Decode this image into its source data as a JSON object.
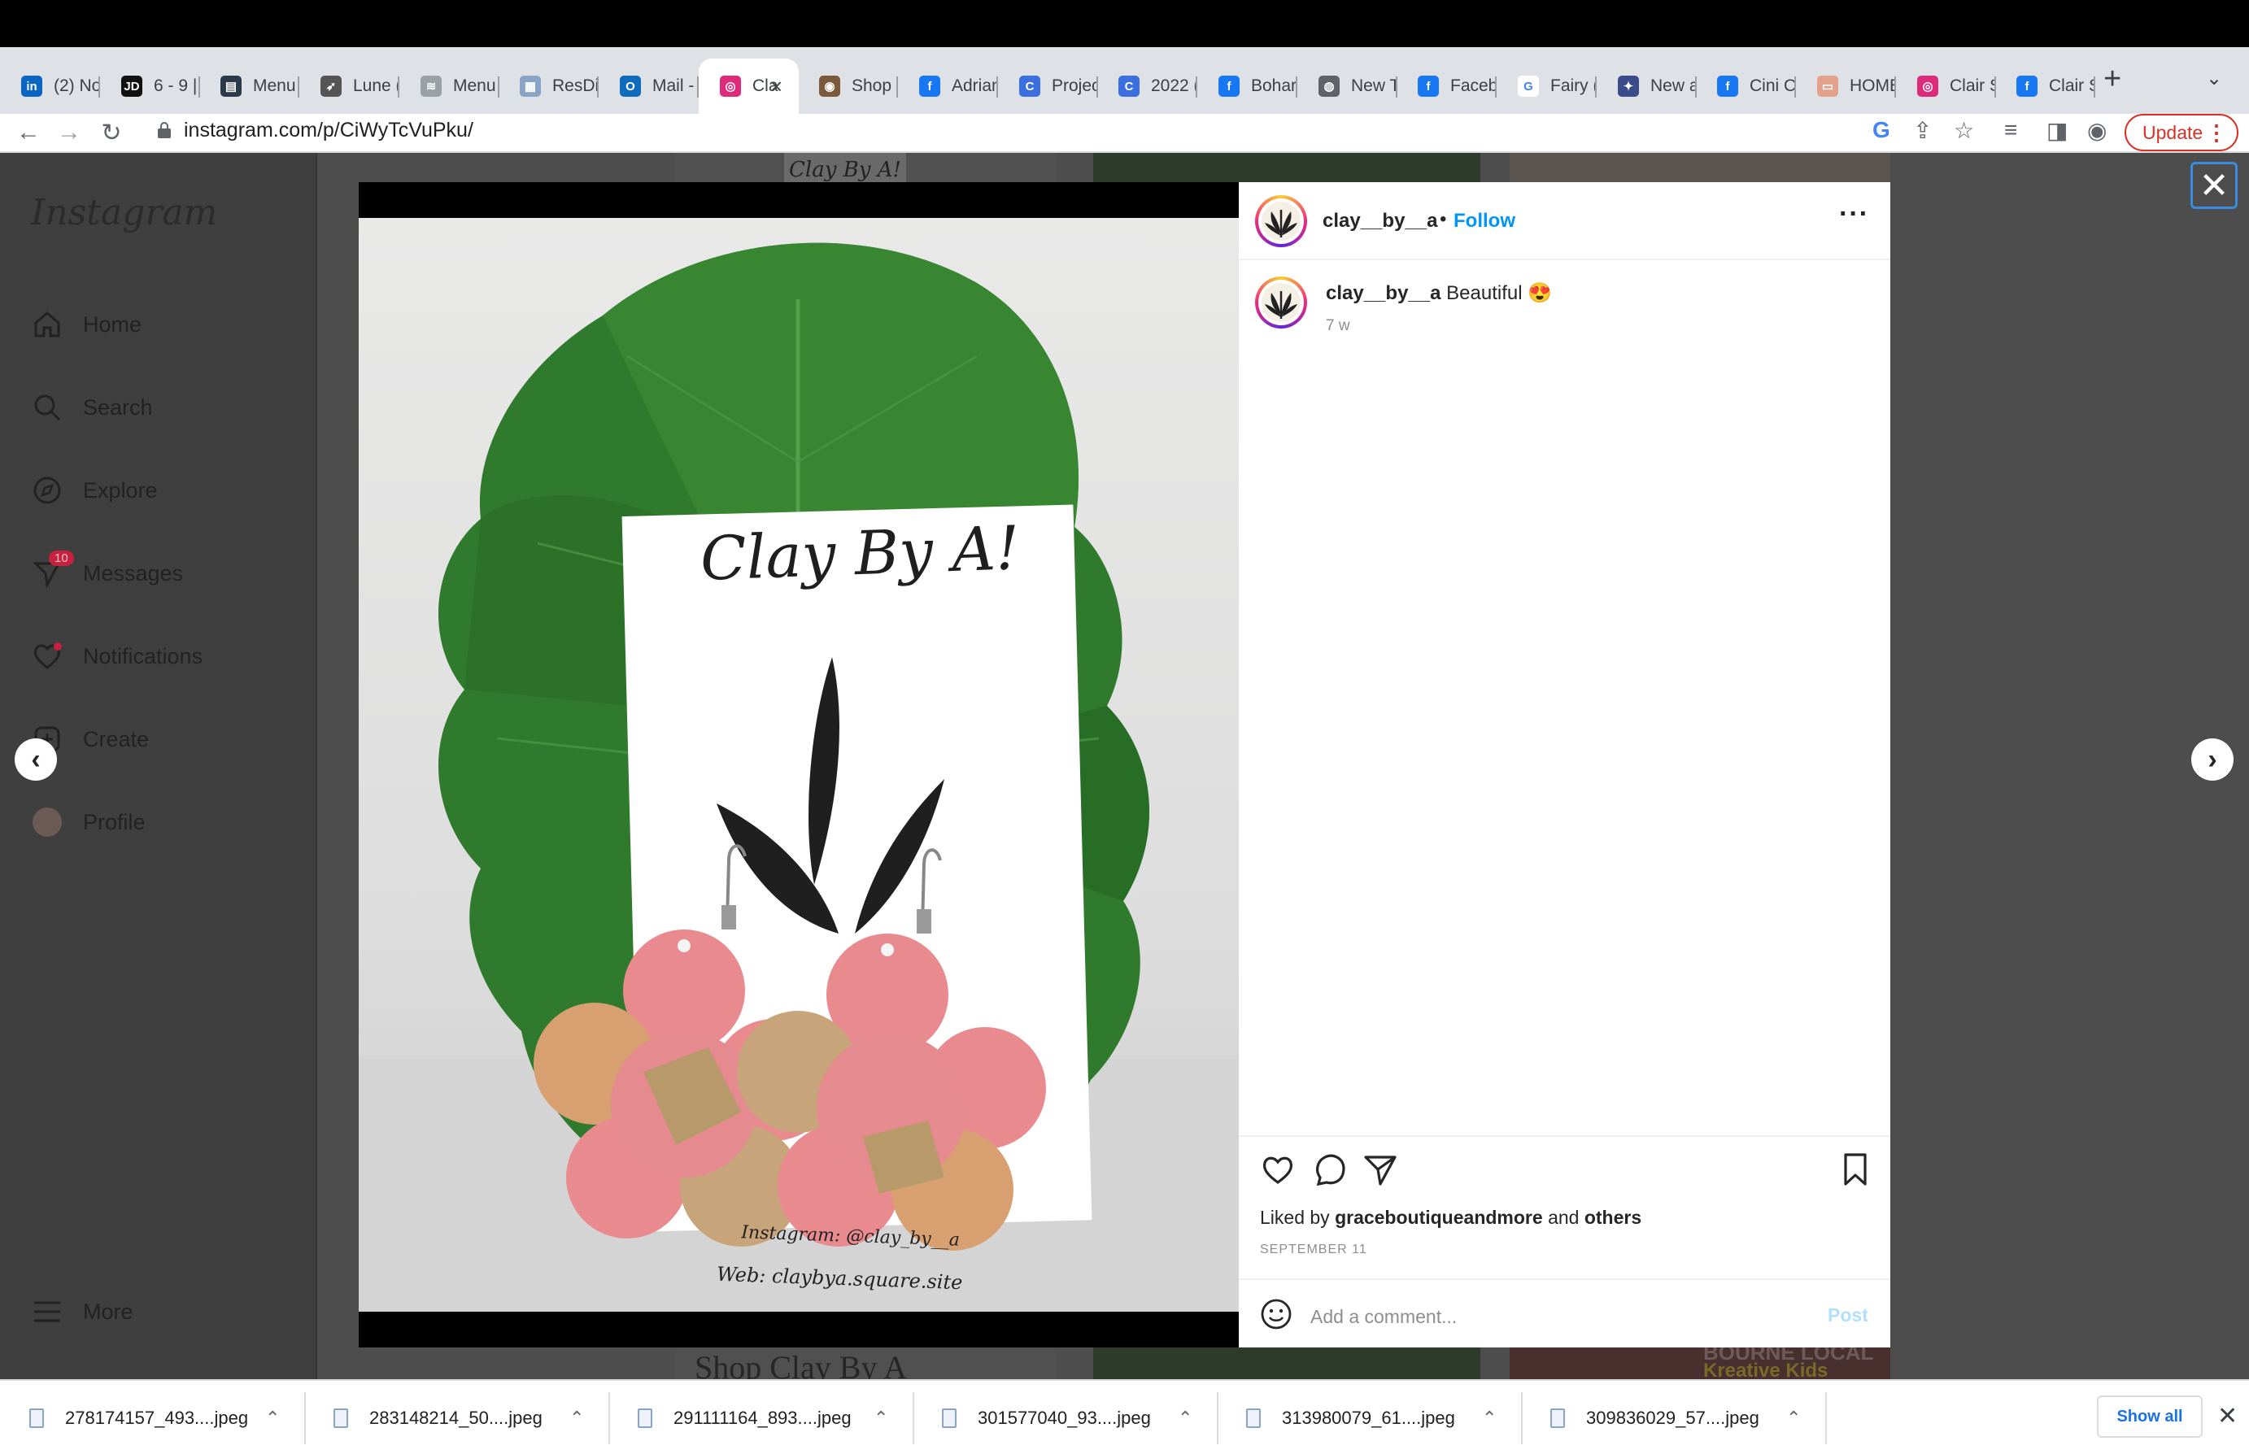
{
  "browser": {
    "tabs": [
      {
        "title": "(2) No",
        "favicon": "linkedin-icon",
        "color": "#0a66c2",
        "glyph": "in"
      },
      {
        "title": "6 - 9 |",
        "favicon": "jd-icon",
        "color": "#111111",
        "glyph": "JD"
      },
      {
        "title": "Menu",
        "favicon": "menu-site-icon",
        "color": "#2b3a4a",
        "glyph": "▤"
      },
      {
        "title": "Lune (",
        "favicon": "rocket-icon",
        "color": "#555555",
        "glyph": "➶"
      },
      {
        "title": "Menu",
        "favicon": "wifi-icon",
        "color": "#9aa0a6",
        "glyph": "≋"
      },
      {
        "title": "ResDi",
        "favicon": "doc-icon",
        "color": "#8aa4c8",
        "glyph": "▦"
      },
      {
        "title": "Mail -",
        "favicon": "outlook-icon",
        "color": "#0f6cbd",
        "glyph": "O"
      },
      {
        "title": "Cla",
        "favicon": "instagram-icon",
        "color": "#dd2a7b",
        "glyph": "◎",
        "active": true
      },
      {
        "title": "Shop /",
        "favicon": "shop-icon",
        "color": "#7a5a3a",
        "glyph": "◉"
      },
      {
        "title": "Adrian",
        "favicon": "facebook-icon",
        "color": "#1877f2",
        "glyph": "f"
      },
      {
        "title": "Projec",
        "favicon": "canva-icon",
        "color": "#3b6fe0",
        "glyph": "C"
      },
      {
        "title": "2022 (",
        "favicon": "canva-icon",
        "color": "#3b6fe0",
        "glyph": "C"
      },
      {
        "title": "Bohar",
        "favicon": "facebook-icon",
        "color": "#1877f2",
        "glyph": "f"
      },
      {
        "title": "New T",
        "favicon": "chrome-icon",
        "color": "#5f6368",
        "glyph": "◍"
      },
      {
        "title": "Faceb",
        "favicon": "facebook-icon",
        "color": "#1877f2",
        "glyph": "f"
      },
      {
        "title": "Fairy (",
        "favicon": "google-icon",
        "color": "#ffffff",
        "glyph": "G"
      },
      {
        "title": "New a",
        "favicon": "shield-icon",
        "color": "#3a4c8a",
        "glyph": "✦"
      },
      {
        "title": "Cini Cl",
        "favicon": "facebook-icon",
        "color": "#1877f2",
        "glyph": "f"
      },
      {
        "title": "HOME",
        "favicon": "home-site-icon",
        "color": "#e3a08a",
        "glyph": "▭"
      },
      {
        "title": "Clair S",
        "favicon": "instagram-icon",
        "color": "#dd2a7b",
        "glyph": "◎"
      },
      {
        "title": "Clair S",
        "favicon": "facebook-icon",
        "color": "#1877f2",
        "glyph": "f"
      }
    ],
    "new_tab": "+",
    "tab_menu": "⌄",
    "url": "instagram.com/p/CiWyTcVuPku/",
    "update_label": "Update",
    "back_icon": "←",
    "forward_icon": "→",
    "reload_icon": "↻"
  },
  "sidebar": {
    "logo": "Instagram",
    "items": [
      {
        "label": "Home",
        "icon": "home-icon"
      },
      {
        "label": "Search",
        "icon": "search-icon"
      },
      {
        "label": "Explore",
        "icon": "compass-icon"
      },
      {
        "label": "Messages",
        "icon": "messenger-icon",
        "badge": "10"
      },
      {
        "label": "Notifications",
        "icon": "heart-icon"
      },
      {
        "label": "Create",
        "icon": "plus-square-icon"
      },
      {
        "label": "Profile",
        "icon": "avatar"
      }
    ],
    "more_label": "More"
  },
  "background": {
    "card_text_top": "Clay By A!",
    "shop_text": "Shop Clay By A",
    "right_text_1": "BOURNE LOCAL",
    "right_text_2": "Kreative Kids"
  },
  "post": {
    "card_title": "Clay By A!",
    "card_handle": "Instagram: @clay_by__a",
    "card_web": "Web: claybya.square.site",
    "username": "clay__by__a",
    "dot": "•",
    "follow_label": "Follow",
    "caption_user": "clay__by__a",
    "caption_text": "Beautiful 😍",
    "age": "7 w",
    "liked_prefix": "Liked by",
    "liked_user": "graceboutiqueandmore",
    "liked_and": "and",
    "liked_others": "others",
    "date": "SEPTEMBER 11",
    "comment_placeholder": "Add a comment...",
    "post_label": "Post"
  },
  "modal": {
    "close": "✕",
    "prev": "‹",
    "next": "›"
  },
  "downloads": {
    "items": [
      {
        "name": "278174157_493....jpeg"
      },
      {
        "name": "283148214_50....jpeg"
      },
      {
        "name": "291111164_893....jpeg"
      },
      {
        "name": "301577040_93....jpeg"
      },
      {
        "name": "313980079_61....jpeg"
      },
      {
        "name": "309836029_57....jpeg"
      }
    ],
    "show_all": "Show all",
    "close": "✕",
    "chevron": "⌃"
  },
  "colors": {
    "instagram_blue": "#0095f6",
    "update_red": "#d93025",
    "leaf_green": "#2e7d32",
    "earring_pink": "#e98a8f",
    "earring_gold": "#b8996a"
  }
}
